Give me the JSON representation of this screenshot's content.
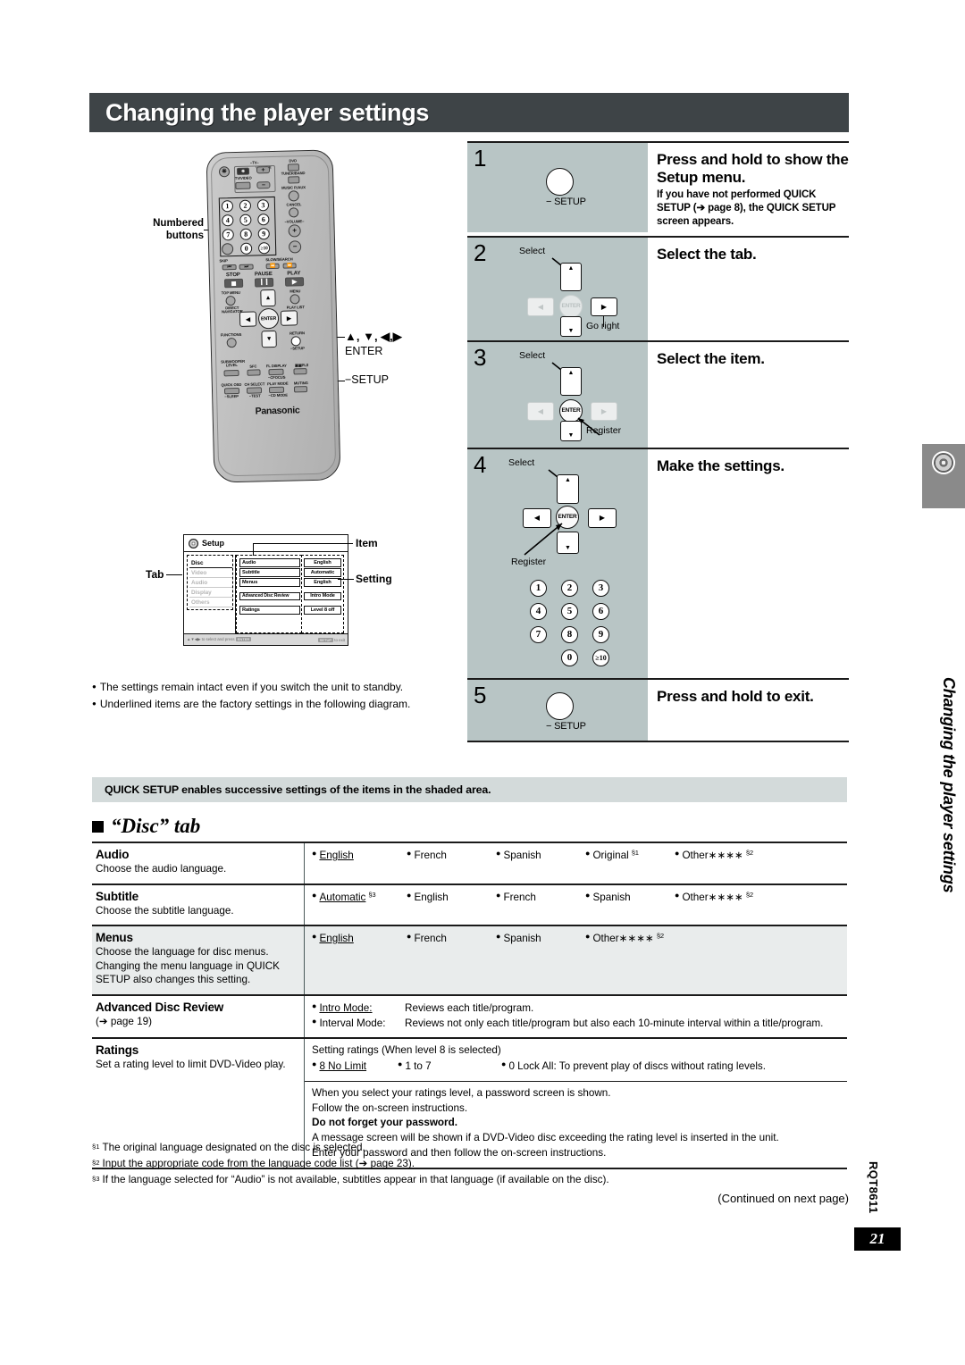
{
  "page": {
    "title": "Changing the player settings",
    "side_text": "Changing the player settings",
    "number": "21",
    "doc_code": "RQT8611",
    "continued": "(Continued on next page)"
  },
  "remote": {
    "callout_numbered": "Numbered\nbuttons",
    "callout_dpad": "▲, ▼, ◀, ▶",
    "callout_enter": "ENTER",
    "callout_setup": "−SETUP",
    "brand": "Panasonic",
    "labels": {
      "tv": "TV",
      "tv_video": "TV/VIDEO",
      "volume": "VOLUME",
      "dvd": "DVD",
      "tuner_band": "TUNER/BAND",
      "music_p_aux": "MUSIC P./AUX",
      "cancel": "CANCEL",
      "volume2": "VOLUME",
      "skip": "SKIP",
      "slow_search": "SLOW/SEARCH",
      "stop": "STOP",
      "pause": "PAUSE",
      "play": "PLAY",
      "top_menu": "TOP MENU",
      "direct_navigator": "DIRECT NAVIGATOR",
      "menu": "MENU",
      "play_list": "PLAY LIST",
      "functions": "FUNCTIONS",
      "return": "RETURN",
      "setup": "−SETUP",
      "enter": "ENTER",
      "subwoofer_level": "SUBWOOFER\nLEVEL",
      "sfc": "SFC",
      "fl_display": "FL DISPLAY",
      "cfocus": "−CFOCUS",
      "dd_pl2": "□□PLⅡ",
      "quick_osd": "QUICK OSD",
      "sleep": "−SLEEP",
      "ch_select": "CH SELECT",
      "test": "−TEST",
      "play_mode": "PLAY MODE",
      "cd_mode": "−CD MODE",
      "muting": "MUTING"
    },
    "numbers": [
      "1",
      "2",
      "3",
      "4",
      "5",
      "6",
      "7",
      "8",
      "9",
      "0",
      "≥10"
    ]
  },
  "setup_mock": {
    "header": "Setup",
    "callout_tab": "Tab",
    "callout_item": "Item",
    "callout_setting": "Setting",
    "tabs": [
      "Disc",
      "Video",
      "Audio",
      "Display",
      "Others"
    ],
    "items": [
      "Audio",
      "Subtitle",
      "Menus",
      "Advanced Disc Review",
      "Ratings"
    ],
    "settings": [
      "English",
      "Automatic",
      "English",
      "Intro Mode",
      "Level 8 off"
    ],
    "footer_left": "▲▼◀▶ to select and press",
    "footer_left_key": "ENTER",
    "footer_right_key": "SETUP",
    "footer_right": "to exit"
  },
  "steps": [
    {
      "num": "1",
      "heading": "Press and hold to show the Setup menu.",
      "sub": "If you have not performed QUICK SETUP (➔ page 8), the QUICK SETUP screen appears.",
      "button_caption": "− SETUP"
    },
    {
      "num": "2",
      "heading": "Select the tab.",
      "label_select": "Select",
      "label_action": "Go right",
      "enter_label": "ENTER"
    },
    {
      "num": "3",
      "heading": "Select the item.",
      "label_select": "Select",
      "label_action": "Register",
      "enter_label": "ENTER"
    },
    {
      "num": "4",
      "heading": "Make the settings.",
      "label_select": "Select",
      "label_action": "Register",
      "enter_label": "ENTER"
    },
    {
      "num": "5",
      "heading": "Press and hold to exit.",
      "button_caption": "− SETUP"
    }
  ],
  "notes": [
    "The settings remain intact even if you switch the unit to standby.",
    "Underlined items are the factory settings in the following diagram."
  ],
  "quick_banner": "QUICK SETUP enables successive settings of the items in the shaded area.",
  "section_heading": "“Disc” tab",
  "table": {
    "rows": [
      {
        "name": "Audio",
        "desc": "Choose the audio language.",
        "shaded": false,
        "options": [
          {
            "label": "English",
            "underline": true,
            "sup": ""
          },
          {
            "label": "French",
            "underline": false,
            "sup": ""
          },
          {
            "label": "Spanish",
            "underline": false,
            "sup": ""
          },
          {
            "label": "Original",
            "underline": false,
            "sup": "§1"
          },
          {
            "label": "Other∗∗∗∗",
            "underline": false,
            "sup": "§2"
          }
        ]
      },
      {
        "name": "Subtitle",
        "desc": "Choose the subtitle language.",
        "shaded": false,
        "options": [
          {
            "label": "Automatic",
            "underline": true,
            "sup": "§3"
          },
          {
            "label": "English",
            "underline": false,
            "sup": ""
          },
          {
            "label": "French",
            "underline": false,
            "sup": ""
          },
          {
            "label": "Spanish",
            "underline": false,
            "sup": ""
          },
          {
            "label": "Other∗∗∗∗",
            "underline": false,
            "sup": "§2"
          }
        ]
      },
      {
        "name": "Menus",
        "desc": "Choose the language for disc menus. Changing the menu language in QUICK SETUP also changes this setting.",
        "shaded": true,
        "options": [
          {
            "label": "English",
            "underline": true,
            "sup": ""
          },
          {
            "label": "French",
            "underline": false,
            "sup": ""
          },
          {
            "label": "Spanish",
            "underline": false,
            "sup": ""
          },
          {
            "label": "Other∗∗∗∗",
            "underline": false,
            "sup": "§2"
          }
        ]
      }
    ],
    "advanced": {
      "name": "Advanced Disc Review",
      "desc": "(➔ page 19)",
      "lines": [
        {
          "label": "Intro Mode:",
          "underline": true,
          "text": "Reviews each title/program."
        },
        {
          "label": "Interval Mode:",
          "underline": false,
          "text": "Reviews not only each title/program but also each 10-minute interval within a title/program."
        }
      ]
    },
    "ratings": {
      "name": "Ratings",
      "desc": "Set a rating level to limit DVD-Video play.",
      "intro": "Setting ratings (When level 8 is selected)",
      "options": [
        {
          "label": "8 No Limit",
          "underline": true
        },
        {
          "label": "1 to 7",
          "underline": false
        },
        {
          "label": "0 Lock All: To prevent play of discs without rating levels.",
          "underline": false
        }
      ],
      "paragraph": [
        "When you select your ratings level, a password screen is shown.",
        "Follow the on-screen instructions.",
        "Do not forget your password.",
        "A message screen will be shown if a DVD-Video disc exceeding the rating level is inserted in the unit.",
        "Enter your password and then follow the on-screen instructions."
      ]
    }
  },
  "footnotes": [
    {
      "mark": "§1",
      "text": "The original language designated on the disc is selected."
    },
    {
      "mark": "§2",
      "text": "Input the appropriate code from the language code list (➔ page 23)."
    },
    {
      "mark": "§3",
      "text": "If the language selected for “Audio” is not available, subtitles appear in that language (if available on the disc)."
    }
  ]
}
